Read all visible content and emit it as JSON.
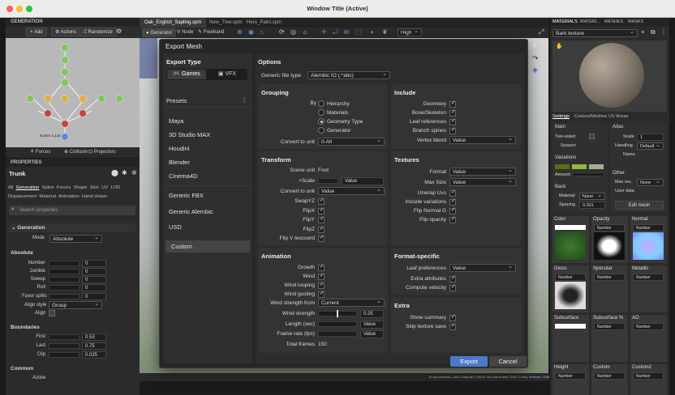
{
  "window": {
    "title": "Window Title (Active)"
  },
  "generation": {
    "title": "GENERATION",
    "add": "Add",
    "actions": "Actions",
    "randomize": "Randomize",
    "nodes_info": "Nodes 4,123",
    "bottom": [
      "Forces",
      "Collision",
      "Projectors"
    ]
  },
  "properties": {
    "title": "PROPERTIES",
    "object": "Trunk",
    "tabs": [
      "All",
      "Generation",
      "Spine",
      "Forces",
      "Shape",
      "Skin",
      "UV",
      "LOD"
    ],
    "tabs2": [
      "Displacement",
      "Material",
      "Animation",
      "Hand drawn"
    ],
    "search_placeholder": "Search properties",
    "generation_header": "Generation",
    "mode_label": "Mode",
    "mode_value": "Absolute",
    "absolute_header": "Absolute",
    "absolute_rows": [
      {
        "label": "Number",
        "value": "0"
      },
      {
        "label": "Jumble",
        "value": "0"
      },
      {
        "label": "Sweep",
        "value": "0"
      },
      {
        "label": "Roll",
        "value": "0"
      }
    ],
    "favor_splits": "Favor splits",
    "favor_value": "0",
    "align_style": "Align style",
    "align_value": "Group",
    "align": "Align",
    "boundaries_header": "Boundaries",
    "boundary_rows": [
      {
        "label": "First",
        "value": "0.53"
      },
      {
        "label": "Last",
        "value": "0.75"
      },
      {
        "label": "Clip",
        "value": "0.025"
      }
    ],
    "common_header": "Common",
    "active": "Active"
  },
  "doc_tabs": [
    "Oak_English_Sapling.spm",
    "New_Tree.spm",
    "Hero_Palm.spm"
  ],
  "viewport_toolbar": {
    "generator": "Generator",
    "node": "Node",
    "freehand": "Freehand",
    "quality": "High"
  },
  "dialog": {
    "title": "Export Mesh",
    "export_type": "Export Type",
    "games": "Games",
    "vfx": "VFX",
    "presets": "Presets",
    "presets_list": [
      "Maya",
      "3D Studio MAX",
      "Houdini",
      "Blender",
      "Cinema4D",
      "Generic FBX",
      "Generic Alembic",
      "USD",
      "Custom"
    ],
    "options": "Options",
    "file_type_label": "Generic file type",
    "file_type_value": "Alembic IO (.*abc)",
    "grouping": {
      "title": "Grouping",
      "by": "By",
      "options": [
        "Hierarchy",
        "Materials",
        "Geometry Type",
        "Generator"
      ],
      "selected": "Geometry Type",
      "convert_label": "Convert to unit",
      "convert_value": "0-All"
    },
    "include": {
      "title": "Include",
      "items": [
        "Geomtery",
        "Bone/Skeleton",
        "Leaf references",
        "Branch spines"
      ],
      "vertex_blend": "Vertex blend",
      "vertex_value": "Value"
    },
    "transform": {
      "title": "Transform",
      "scene_unit": "Scene unit",
      "scene_value": "Foot",
      "scale": "+Scale",
      "scale_value": "Value",
      "convert": "Convert to unit",
      "convert_value": "Value",
      "checks": [
        "SwapYZ",
        "FlipX",
        "FlipY",
        "FlipZ",
        "Flip V texcoord"
      ]
    },
    "textures": {
      "title": "Textures",
      "format": "Format",
      "format_value": "Value",
      "maxsize": "Max Size",
      "maxsize_value": "Value",
      "checks": [
        "Unwrap Uvs",
        "Include variations",
        "Flip Normal G",
        "Flip opacity"
      ]
    },
    "animation": {
      "title": "Animation",
      "checks": [
        "Growth",
        "Wind",
        "Wind looping",
        "Wind gusting"
      ],
      "strength_from": "Wind strength from",
      "strength_from_value": "Current",
      "strength": "Wind strength",
      "strength_value": "0.25",
      "length": "Length (sec)",
      "length_value": "Value",
      "framerate": "Frame rate (fps)",
      "framerate_value": "Value",
      "total": "Total frames",
      "total_value": "150"
    },
    "format_specific": {
      "title": "Format-specific",
      "leaf_pref": "Leaf preferences",
      "leaf_value": "Value",
      "checks": [
        "Extra attributes",
        "Compute velocity"
      ]
    },
    "extra": {
      "title": "Extra",
      "checks": [
        "Show summary",
        "Skip texture save"
      ]
    },
    "export": "Export",
    "cancel": "Cancel"
  },
  "status_text": "16 cpu threads), Last Compute 2 (50.61 ms (frame time 2010.71 ms), Vertices 73.86",
  "materials": {
    "tabs": [
      "MATERIALS",
      "MATERI...",
      "MESHES",
      "MASKS"
    ],
    "current": "Bark texture",
    "subtabs": [
      "Settings",
      "Cutoes/Meshes",
      "UV Areas"
    ],
    "main": "Main",
    "two_sided": "Two-sided",
    "season": "Season",
    "atlas": "Atlas",
    "scale": "Scale",
    "scale_value": "1",
    "handling": "Handling",
    "handling_value": "Default",
    "name": "Name",
    "variations": "Variations",
    "amount": "Amount",
    "other": "Other",
    "max_res": "Max res.",
    "max_res_value": "None",
    "user_data": "User data",
    "back": "Back",
    "material": "Material",
    "material_value": "None",
    "spacing": "Spacing",
    "spacing_value": "0.001",
    "edit_mesh": "Edit mesh",
    "maps": [
      "Color",
      "Opacity",
      "Normal",
      "Gloss",
      "Specular",
      "Metallic",
      "Subsurface",
      "Subsurface %",
      "AO",
      "Height",
      "Custom",
      "Custom2"
    ],
    "number": "Number",
    "accent": "#4a7ac8"
  }
}
